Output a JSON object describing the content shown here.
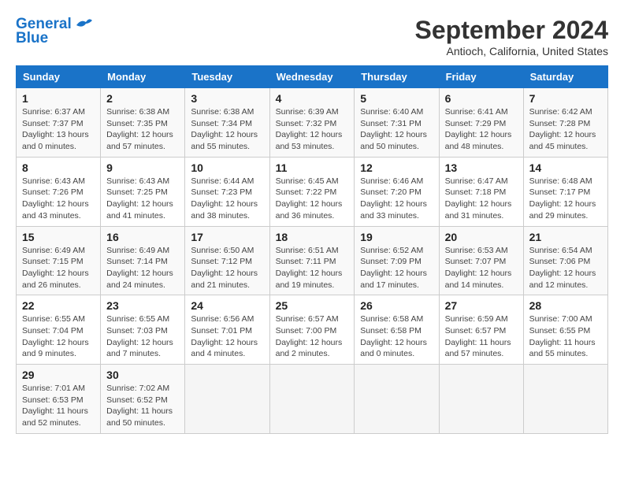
{
  "logo": {
    "line1": "General",
    "line2": "Blue"
  },
  "title": "September 2024",
  "location": "Antioch, California, United States",
  "days_of_week": [
    "Sunday",
    "Monday",
    "Tuesday",
    "Wednesday",
    "Thursday",
    "Friday",
    "Saturday"
  ],
  "weeks": [
    [
      {
        "day": "1",
        "sunrise": "Sunrise: 6:37 AM",
        "sunset": "Sunset: 7:37 PM",
        "daylight": "Daylight: 13 hours and 0 minutes."
      },
      {
        "day": "2",
        "sunrise": "Sunrise: 6:38 AM",
        "sunset": "Sunset: 7:35 PM",
        "daylight": "Daylight: 12 hours and 57 minutes."
      },
      {
        "day": "3",
        "sunrise": "Sunrise: 6:38 AM",
        "sunset": "Sunset: 7:34 PM",
        "daylight": "Daylight: 12 hours and 55 minutes."
      },
      {
        "day": "4",
        "sunrise": "Sunrise: 6:39 AM",
        "sunset": "Sunset: 7:32 PM",
        "daylight": "Daylight: 12 hours and 53 minutes."
      },
      {
        "day": "5",
        "sunrise": "Sunrise: 6:40 AM",
        "sunset": "Sunset: 7:31 PM",
        "daylight": "Daylight: 12 hours and 50 minutes."
      },
      {
        "day": "6",
        "sunrise": "Sunrise: 6:41 AM",
        "sunset": "Sunset: 7:29 PM",
        "daylight": "Daylight: 12 hours and 48 minutes."
      },
      {
        "day": "7",
        "sunrise": "Sunrise: 6:42 AM",
        "sunset": "Sunset: 7:28 PM",
        "daylight": "Daylight: 12 hours and 45 minutes."
      }
    ],
    [
      {
        "day": "8",
        "sunrise": "Sunrise: 6:43 AM",
        "sunset": "Sunset: 7:26 PM",
        "daylight": "Daylight: 12 hours and 43 minutes."
      },
      {
        "day": "9",
        "sunrise": "Sunrise: 6:43 AM",
        "sunset": "Sunset: 7:25 PM",
        "daylight": "Daylight: 12 hours and 41 minutes."
      },
      {
        "day": "10",
        "sunrise": "Sunrise: 6:44 AM",
        "sunset": "Sunset: 7:23 PM",
        "daylight": "Daylight: 12 hours and 38 minutes."
      },
      {
        "day": "11",
        "sunrise": "Sunrise: 6:45 AM",
        "sunset": "Sunset: 7:22 PM",
        "daylight": "Daylight: 12 hours and 36 minutes."
      },
      {
        "day": "12",
        "sunrise": "Sunrise: 6:46 AM",
        "sunset": "Sunset: 7:20 PM",
        "daylight": "Daylight: 12 hours and 33 minutes."
      },
      {
        "day": "13",
        "sunrise": "Sunrise: 6:47 AM",
        "sunset": "Sunset: 7:18 PM",
        "daylight": "Daylight: 12 hours and 31 minutes."
      },
      {
        "day": "14",
        "sunrise": "Sunrise: 6:48 AM",
        "sunset": "Sunset: 7:17 PM",
        "daylight": "Daylight: 12 hours and 29 minutes."
      }
    ],
    [
      {
        "day": "15",
        "sunrise": "Sunrise: 6:49 AM",
        "sunset": "Sunset: 7:15 PM",
        "daylight": "Daylight: 12 hours and 26 minutes."
      },
      {
        "day": "16",
        "sunrise": "Sunrise: 6:49 AM",
        "sunset": "Sunset: 7:14 PM",
        "daylight": "Daylight: 12 hours and 24 minutes."
      },
      {
        "day": "17",
        "sunrise": "Sunrise: 6:50 AM",
        "sunset": "Sunset: 7:12 PM",
        "daylight": "Daylight: 12 hours and 21 minutes."
      },
      {
        "day": "18",
        "sunrise": "Sunrise: 6:51 AM",
        "sunset": "Sunset: 7:11 PM",
        "daylight": "Daylight: 12 hours and 19 minutes."
      },
      {
        "day": "19",
        "sunrise": "Sunrise: 6:52 AM",
        "sunset": "Sunset: 7:09 PM",
        "daylight": "Daylight: 12 hours and 17 minutes."
      },
      {
        "day": "20",
        "sunrise": "Sunrise: 6:53 AM",
        "sunset": "Sunset: 7:07 PM",
        "daylight": "Daylight: 12 hours and 14 minutes."
      },
      {
        "day": "21",
        "sunrise": "Sunrise: 6:54 AM",
        "sunset": "Sunset: 7:06 PM",
        "daylight": "Daylight: 12 hours and 12 minutes."
      }
    ],
    [
      {
        "day": "22",
        "sunrise": "Sunrise: 6:55 AM",
        "sunset": "Sunset: 7:04 PM",
        "daylight": "Daylight: 12 hours and 9 minutes."
      },
      {
        "day": "23",
        "sunrise": "Sunrise: 6:55 AM",
        "sunset": "Sunset: 7:03 PM",
        "daylight": "Daylight: 12 hours and 7 minutes."
      },
      {
        "day": "24",
        "sunrise": "Sunrise: 6:56 AM",
        "sunset": "Sunset: 7:01 PM",
        "daylight": "Daylight: 12 hours and 4 minutes."
      },
      {
        "day": "25",
        "sunrise": "Sunrise: 6:57 AM",
        "sunset": "Sunset: 7:00 PM",
        "daylight": "Daylight: 12 hours and 2 minutes."
      },
      {
        "day": "26",
        "sunrise": "Sunrise: 6:58 AM",
        "sunset": "Sunset: 6:58 PM",
        "daylight": "Daylight: 12 hours and 0 minutes."
      },
      {
        "day": "27",
        "sunrise": "Sunrise: 6:59 AM",
        "sunset": "Sunset: 6:57 PM",
        "daylight": "Daylight: 11 hours and 57 minutes."
      },
      {
        "day": "28",
        "sunrise": "Sunrise: 7:00 AM",
        "sunset": "Sunset: 6:55 PM",
        "daylight": "Daylight: 11 hours and 55 minutes."
      }
    ],
    [
      {
        "day": "29",
        "sunrise": "Sunrise: 7:01 AM",
        "sunset": "Sunset: 6:53 PM",
        "daylight": "Daylight: 11 hours and 52 minutes."
      },
      {
        "day": "30",
        "sunrise": "Sunrise: 7:02 AM",
        "sunset": "Sunset: 6:52 PM",
        "daylight": "Daylight: 11 hours and 50 minutes."
      },
      null,
      null,
      null,
      null,
      null
    ]
  ]
}
